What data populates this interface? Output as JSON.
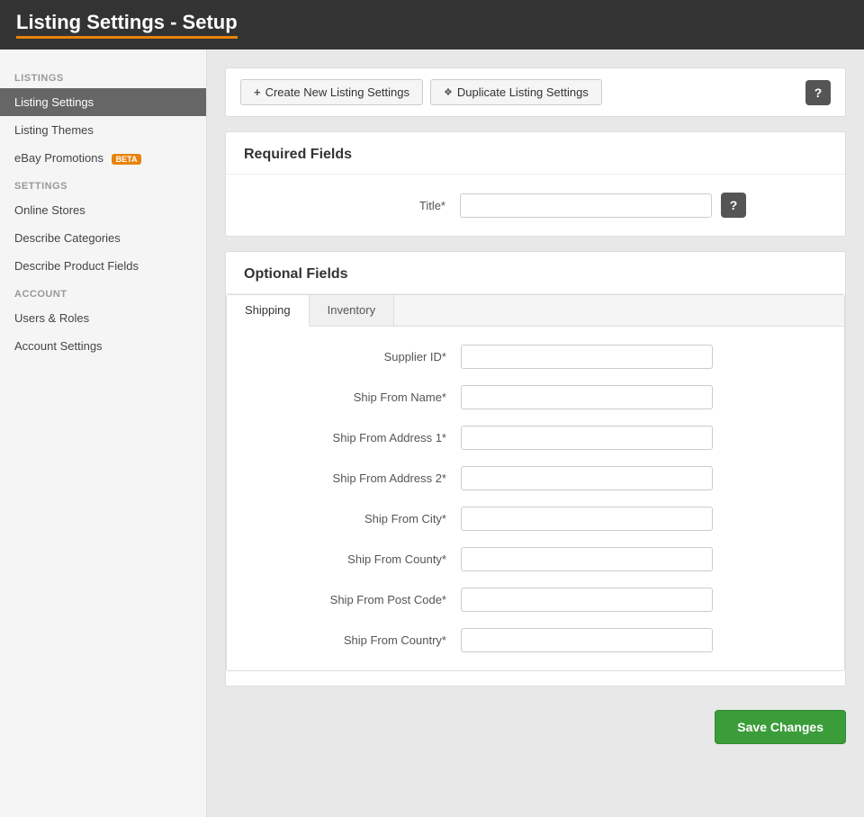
{
  "header": {
    "title": "Listing Settings - Setup"
  },
  "sidebar": {
    "listings_label": "Listings",
    "settings_label": "Settings",
    "account_label": "Account",
    "items": {
      "listing_settings": "Listing Settings",
      "listing_themes": "Listing Themes",
      "ebay_promotions": "eBay Promotions",
      "beta_badge": "BETA",
      "online_stores": "Online Stores",
      "describe_categories": "Describe Categories",
      "describe_product_fields": "Describe Product Fields",
      "users_roles": "Users & Roles",
      "account_settings": "Account Settings"
    }
  },
  "toolbar": {
    "create_label": "Create New Listing Settings",
    "duplicate_label": "Duplicate Listing Settings",
    "help_icon": "?"
  },
  "required_fields": {
    "section_title": "Required Fields",
    "title_label": "Title*",
    "title_value": "",
    "help_icon": "?"
  },
  "optional_fields": {
    "section_title": "Optional Fields",
    "tabs": [
      {
        "id": "shipping",
        "label": "Shipping",
        "active": true
      },
      {
        "id": "inventory",
        "label": "Inventory",
        "active": false
      }
    ],
    "shipping_fields": [
      {
        "label": "Supplier ID*",
        "value": ""
      },
      {
        "label": "Ship From Name*",
        "value": ""
      },
      {
        "label": "Ship From Address 1*",
        "value": ""
      },
      {
        "label": "Ship From Address 2*",
        "value": ""
      },
      {
        "label": "Ship From City*",
        "value": ""
      },
      {
        "label": "Ship From County*",
        "value": ""
      },
      {
        "label": "Ship From Post Code*",
        "value": ""
      },
      {
        "label": "Ship From Country*",
        "value": ""
      }
    ]
  },
  "footer": {
    "save_label": "Save Changes"
  }
}
